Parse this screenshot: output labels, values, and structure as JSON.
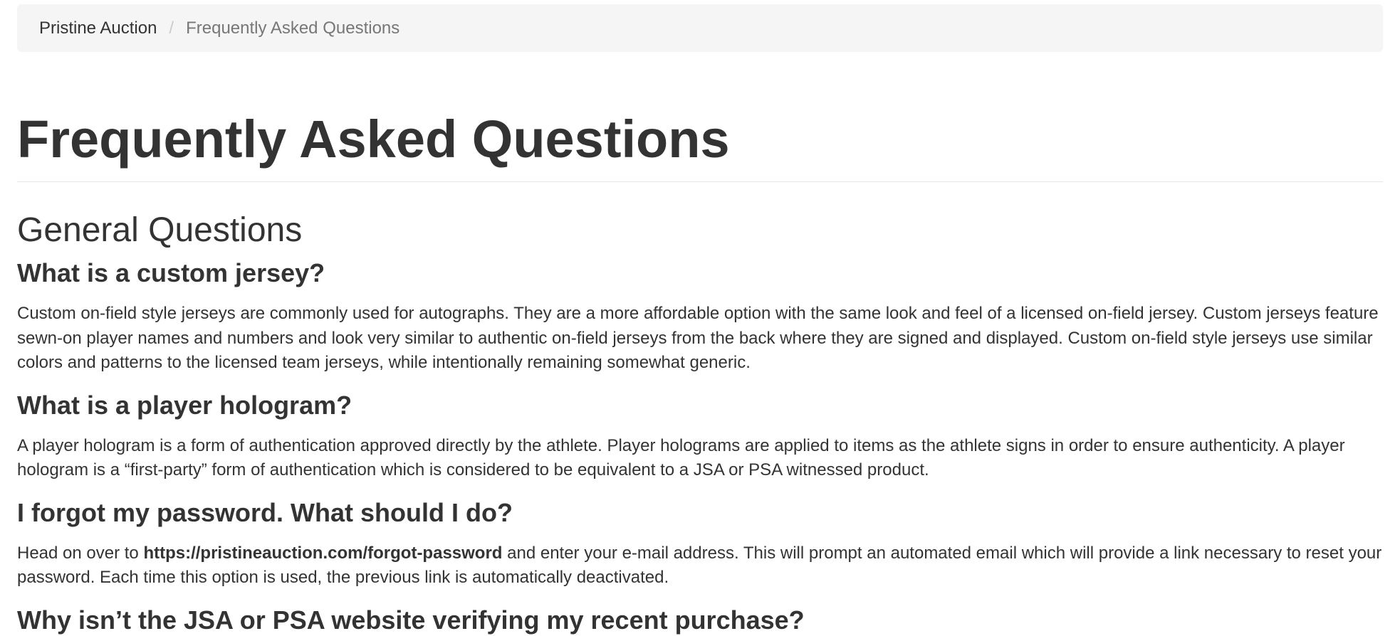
{
  "breadcrumb": {
    "home": "Pristine Auction",
    "separator": "/",
    "current": "Frequently Asked Questions"
  },
  "page": {
    "title": "Frequently Asked Questions"
  },
  "section": {
    "title": "General Questions"
  },
  "faqs": [
    {
      "question": "What is a custom jersey?",
      "answer": "Custom on-field style jerseys are commonly used for autographs. They are a more affordable option with the same look and feel of a licensed on-field jersey. Custom jerseys feature sewn-on player names and numbers and look very similar to authentic on-field jerseys from the back where they are signed and displayed. Custom on-field style jerseys use similar colors and patterns to the licensed team jerseys, while intentionally remaining somewhat generic."
    },
    {
      "question": "What is a player hologram?",
      "answer": "A player hologram is a form of authentication approved directly by the athlete. Player holograms are applied to items as the athlete signs in order to ensure authenticity. A player hologram is a “first-party” form of authentication which is considered to be equivalent to a JSA or PSA witnessed product."
    },
    {
      "question": "I forgot my password. What should I do?",
      "answer_prefix": "Head on over to ",
      "answer_link": "https://pristineauction.com/forgot-password",
      "answer_suffix": " and enter your e-mail address. This will prompt an automated email which will provide a link necessary to reset your password. Each time this option is used, the previous link is automatically deactivated."
    },
    {
      "question": "Why isn’t the JSA or PSA website verifying my recent purchase?"
    }
  ]
}
